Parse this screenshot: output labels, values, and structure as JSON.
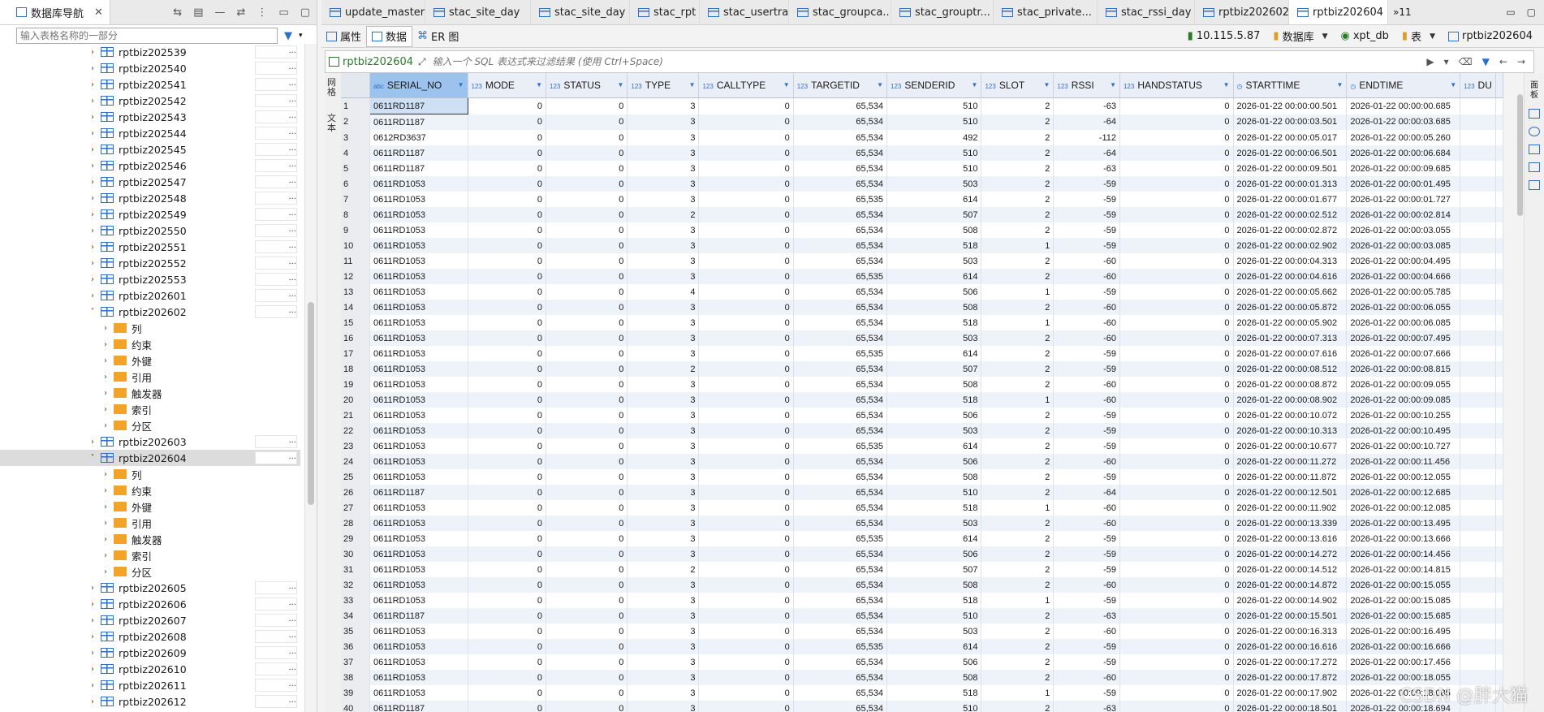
{
  "navigator": {
    "tab_label": "数据库导航",
    "filter_placeholder": "输入表格名称的一部分",
    "tree": [
      {
        "label": "rptbiz202539",
        "level": 1,
        "type": "table",
        "expanded": false
      },
      {
        "label": "rptbiz202540",
        "level": 1,
        "type": "table",
        "expanded": false
      },
      {
        "label": "rptbiz202541",
        "level": 1,
        "type": "table",
        "expanded": false
      },
      {
        "label": "rptbiz202542",
        "level": 1,
        "type": "table",
        "expanded": false
      },
      {
        "label": "rptbiz202543",
        "level": 1,
        "type": "table",
        "expanded": false
      },
      {
        "label": "rptbiz202544",
        "level": 1,
        "type": "table",
        "expanded": false
      },
      {
        "label": "rptbiz202545",
        "level": 1,
        "type": "table",
        "expanded": false
      },
      {
        "label": "rptbiz202546",
        "level": 1,
        "type": "table",
        "expanded": false
      },
      {
        "label": "rptbiz202547",
        "level": 1,
        "type": "table",
        "expanded": false
      },
      {
        "label": "rptbiz202548",
        "level": 1,
        "type": "table",
        "expanded": false
      },
      {
        "label": "rptbiz202549",
        "level": 1,
        "type": "table",
        "expanded": false
      },
      {
        "label": "rptbiz202550",
        "level": 1,
        "type": "table",
        "expanded": false
      },
      {
        "label": "rptbiz202551",
        "level": 1,
        "type": "table",
        "expanded": false
      },
      {
        "label": "rptbiz202552",
        "level": 1,
        "type": "table",
        "expanded": false
      },
      {
        "label": "rptbiz202553",
        "level": 1,
        "type": "table",
        "expanded": false
      },
      {
        "label": "rptbiz202601",
        "level": 1,
        "type": "table",
        "expanded": false
      },
      {
        "label": "rptbiz202602",
        "level": 1,
        "type": "table",
        "expanded": true
      },
      {
        "label": "列",
        "level": 2,
        "type": "col"
      },
      {
        "label": "约束",
        "level": 2,
        "type": "con"
      },
      {
        "label": "外键",
        "level": 2,
        "type": "folder"
      },
      {
        "label": "引用",
        "level": 2,
        "type": "folder"
      },
      {
        "label": "触发器",
        "level": 2,
        "type": "folder"
      },
      {
        "label": "索引",
        "level": 2,
        "type": "folder"
      },
      {
        "label": "分区",
        "level": 2,
        "type": "folder"
      },
      {
        "label": "rptbiz202603",
        "level": 1,
        "type": "table",
        "expanded": false
      },
      {
        "label": "rptbiz202604",
        "level": 1,
        "type": "table",
        "expanded": true,
        "selected": true
      },
      {
        "label": "列",
        "level": 2,
        "type": "col"
      },
      {
        "label": "约束",
        "level": 2,
        "type": "con"
      },
      {
        "label": "外键",
        "level": 2,
        "type": "folder"
      },
      {
        "label": "引用",
        "level": 2,
        "type": "folder"
      },
      {
        "label": "触发器",
        "level": 2,
        "type": "folder"
      },
      {
        "label": "索引",
        "level": 2,
        "type": "folder"
      },
      {
        "label": "分区",
        "level": 2,
        "type": "folder"
      },
      {
        "label": "rptbiz202605",
        "level": 1,
        "type": "table",
        "expanded": false
      },
      {
        "label": "rptbiz202606",
        "level": 1,
        "type": "table",
        "expanded": false
      },
      {
        "label": "rptbiz202607",
        "level": 1,
        "type": "table",
        "expanded": false
      },
      {
        "label": "rptbiz202608",
        "level": 1,
        "type": "table",
        "expanded": false
      },
      {
        "label": "rptbiz202609",
        "level": 1,
        "type": "table",
        "expanded": false
      },
      {
        "label": "rptbiz202610",
        "level": 1,
        "type": "table",
        "expanded": false
      },
      {
        "label": "rptbiz202611",
        "level": 1,
        "type": "table",
        "expanded": false
      },
      {
        "label": "rptbiz202612",
        "level": 1,
        "type": "table",
        "expanded": false
      }
    ],
    "more_label": "..."
  },
  "editor_tabs": [
    "update_master",
    "stac_site_day",
    "stac_site_day",
    "stac_rpt",
    "stac_usertra...",
    "stac_groupca...",
    "stac_grouptr...",
    "stac_private...",
    "stac_rssi_day",
    "rptbiz202602",
    "rptbiz202604"
  ],
  "active_tab_index": 10,
  "tab_overflow": "»11",
  "view_tabs": [
    "属性",
    "数据",
    "ER 图"
  ],
  "active_view": 1,
  "connection": {
    "host": "10.115.5.87",
    "db_label": "数据库",
    "db": "xpt_db",
    "table_label": "表",
    "table": "rptbiz202604"
  },
  "filter": {
    "table": "rptbiz202604",
    "placeholder": "输入一个 SQL 表达式来过滤结果 (使用 Ctrl+Space)"
  },
  "columns": [
    {
      "name": "SERIAL_NO",
      "type": "abc",
      "align": "left"
    },
    {
      "name": "MODE",
      "type": "123",
      "align": "right"
    },
    {
      "name": "STATUS",
      "type": "123",
      "align": "right"
    },
    {
      "name": "TYPE",
      "type": "123",
      "align": "right"
    },
    {
      "name": "CALLTYPE",
      "type": "123",
      "align": "right"
    },
    {
      "name": "TARGETID",
      "type": "123",
      "align": "right"
    },
    {
      "name": "SENDERID",
      "type": "123",
      "align": "right"
    },
    {
      "name": "SLOT",
      "type": "123",
      "align": "right"
    },
    {
      "name": "RSSI",
      "type": "123",
      "align": "right"
    },
    {
      "name": "HANDSTATUS",
      "type": "123",
      "align": "right"
    },
    {
      "name": "STARTTIME",
      "type": "clock",
      "align": "left"
    },
    {
      "name": "ENDTIME",
      "type": "clock",
      "align": "left"
    },
    {
      "name": "DU",
      "type": "123",
      "align": "left"
    }
  ],
  "rows": [
    [
      "0611RD1187",
      "0",
      "0",
      "3",
      "0",
      "65,534",
      "510",
      "2",
      "-63",
      "0",
      "2026-01-22 00:00:00.501",
      "2026-01-22 00:00:00.685"
    ],
    [
      "0611RD1187",
      "0",
      "0",
      "3",
      "0",
      "65,534",
      "510",
      "2",
      "-64",
      "0",
      "2026-01-22 00:00:03.501",
      "2026-01-22 00:00:03.685"
    ],
    [
      "0612RD3637",
      "0",
      "0",
      "3",
      "0",
      "65,534",
      "492",
      "2",
      "-112",
      "0",
      "2026-01-22 00:00:05.017",
      "2026-01-22 00:00:05.260"
    ],
    [
      "0611RD1187",
      "0",
      "0",
      "3",
      "0",
      "65,534",
      "510",
      "2",
      "-64",
      "0",
      "2026-01-22 00:00:06.501",
      "2026-01-22 00:00:06.684"
    ],
    [
      "0611RD1187",
      "0",
      "0",
      "3",
      "0",
      "65,534",
      "510",
      "2",
      "-63",
      "0",
      "2026-01-22 00:00:09.501",
      "2026-01-22 00:00:09.685"
    ],
    [
      "0611RD1053",
      "0",
      "0",
      "3",
      "0",
      "65,534",
      "503",
      "2",
      "-59",
      "0",
      "2026-01-22 00:00:01.313",
      "2026-01-22 00:00:01.495"
    ],
    [
      "0611RD1053",
      "0",
      "0",
      "3",
      "0",
      "65,535",
      "614",
      "2",
      "-59",
      "0",
      "2026-01-22 00:00:01.677",
      "2026-01-22 00:00:01.727"
    ],
    [
      "0611RD1053",
      "0",
      "0",
      "2",
      "0",
      "65,534",
      "507",
      "2",
      "-59",
      "0",
      "2026-01-22 00:00:02.512",
      "2026-01-22 00:00:02.814"
    ],
    [
      "0611RD1053",
      "0",
      "0",
      "3",
      "0",
      "65,534",
      "508",
      "2",
      "-59",
      "0",
      "2026-01-22 00:00:02.872",
      "2026-01-22 00:00:03.055"
    ],
    [
      "0611RD1053",
      "0",
      "0",
      "3",
      "0",
      "65,534",
      "518",
      "1",
      "-59",
      "0",
      "2026-01-22 00:00:02.902",
      "2026-01-22 00:00:03.085"
    ],
    [
      "0611RD1053",
      "0",
      "0",
      "3",
      "0",
      "65,534",
      "503",
      "2",
      "-60",
      "0",
      "2026-01-22 00:00:04.313",
      "2026-01-22 00:00:04.495"
    ],
    [
      "0611RD1053",
      "0",
      "0",
      "3",
      "0",
      "65,535",
      "614",
      "2",
      "-60",
      "0",
      "2026-01-22 00:00:04.616",
      "2026-01-22 00:00:04.666"
    ],
    [
      "0611RD1053",
      "0",
      "0",
      "4",
      "0",
      "65,534",
      "506",
      "1",
      "-59",
      "0",
      "2026-01-22 00:00:05.662",
      "2026-01-22 00:00:05.785"
    ],
    [
      "0611RD1053",
      "0",
      "0",
      "3",
      "0",
      "65,534",
      "508",
      "2",
      "-60",
      "0",
      "2026-01-22 00:00:05.872",
      "2026-01-22 00:00:06.055"
    ],
    [
      "0611RD1053",
      "0",
      "0",
      "3",
      "0",
      "65,534",
      "518",
      "1",
      "-60",
      "0",
      "2026-01-22 00:00:05.902",
      "2026-01-22 00:00:06.085"
    ],
    [
      "0611RD1053",
      "0",
      "0",
      "3",
      "0",
      "65,534",
      "503",
      "2",
      "-60",
      "0",
      "2026-01-22 00:00:07.313",
      "2026-01-22 00:00:07.495"
    ],
    [
      "0611RD1053",
      "0",
      "0",
      "3",
      "0",
      "65,535",
      "614",
      "2",
      "-59",
      "0",
      "2026-01-22 00:00:07.616",
      "2026-01-22 00:00:07.666"
    ],
    [
      "0611RD1053",
      "0",
      "0",
      "2",
      "0",
      "65,534",
      "507",
      "2",
      "-59",
      "0",
      "2026-01-22 00:00:08.512",
      "2026-01-22 00:00:08.815"
    ],
    [
      "0611RD1053",
      "0",
      "0",
      "3",
      "0",
      "65,534",
      "508",
      "2",
      "-60",
      "0",
      "2026-01-22 00:00:08.872",
      "2026-01-22 00:00:09.055"
    ],
    [
      "0611RD1053",
      "0",
      "0",
      "3",
      "0",
      "65,534",
      "518",
      "1",
      "-60",
      "0",
      "2026-01-22 00:00:08.902",
      "2026-01-22 00:00:09.085"
    ],
    [
      "0611RD1053",
      "0",
      "0",
      "3",
      "0",
      "65,534",
      "506",
      "2",
      "-59",
      "0",
      "2026-01-22 00:00:10.072",
      "2026-01-22 00:00:10.255"
    ],
    [
      "0611RD1053",
      "0",
      "0",
      "3",
      "0",
      "65,534",
      "503",
      "2",
      "-59",
      "0",
      "2026-01-22 00:00:10.313",
      "2026-01-22 00:00:10.495"
    ],
    [
      "0611RD1053",
      "0",
      "0",
      "3",
      "0",
      "65,535",
      "614",
      "2",
      "-59",
      "0",
      "2026-01-22 00:00:10.677",
      "2026-01-22 00:00:10.727"
    ],
    [
      "0611RD1053",
      "0",
      "0",
      "3",
      "0",
      "65,534",
      "506",
      "2",
      "-60",
      "0",
      "2026-01-22 00:00:11.272",
      "2026-01-22 00:00:11.456"
    ],
    [
      "0611RD1053",
      "0",
      "0",
      "3",
      "0",
      "65,534",
      "508",
      "2",
      "-59",
      "0",
      "2026-01-22 00:00:11.872",
      "2026-01-22 00:00:12.055"
    ],
    [
      "0611RD1187",
      "0",
      "0",
      "3",
      "0",
      "65,534",
      "510",
      "2",
      "-64",
      "0",
      "2026-01-22 00:00:12.501",
      "2026-01-22 00:00:12.685"
    ],
    [
      "0611RD1053",
      "0",
      "0",
      "3",
      "0",
      "65,534",
      "518",
      "1",
      "-60",
      "0",
      "2026-01-22 00:00:11.902",
      "2026-01-22 00:00:12.085"
    ],
    [
      "0611RD1053",
      "0",
      "0",
      "3",
      "0",
      "65,534",
      "503",
      "2",
      "-60",
      "0",
      "2026-01-22 00:00:13.339",
      "2026-01-22 00:00:13.495"
    ],
    [
      "0611RD1053",
      "0",
      "0",
      "3",
      "0",
      "65,535",
      "614",
      "2",
      "-59",
      "0",
      "2026-01-22 00:00:13.616",
      "2026-01-22 00:00:13.666"
    ],
    [
      "0611RD1053",
      "0",
      "0",
      "3",
      "0",
      "65,534",
      "506",
      "2",
      "-59",
      "0",
      "2026-01-22 00:00:14.272",
      "2026-01-22 00:00:14.456"
    ],
    [
      "0611RD1053",
      "0",
      "0",
      "2",
      "0",
      "65,534",
      "507",
      "2",
      "-59",
      "0",
      "2026-01-22 00:00:14.512",
      "2026-01-22 00:00:14.815"
    ],
    [
      "0611RD1053",
      "0",
      "0",
      "3",
      "0",
      "65,534",
      "508",
      "2",
      "-60",
      "0",
      "2026-01-22 00:00:14.872",
      "2026-01-22 00:00:15.055"
    ],
    [
      "0611RD1053",
      "0",
      "0",
      "3",
      "0",
      "65,534",
      "518",
      "1",
      "-59",
      "0",
      "2026-01-22 00:00:14.902",
      "2026-01-22 00:00:15.085"
    ],
    [
      "0611RD1187",
      "0",
      "0",
      "3",
      "0",
      "65,534",
      "510",
      "2",
      "-63",
      "0",
      "2026-01-22 00:00:15.501",
      "2026-01-22 00:00:15.685"
    ],
    [
      "0611RD1053",
      "0",
      "0",
      "3",
      "0",
      "65,534",
      "503",
      "2",
      "-60",
      "0",
      "2026-01-22 00:00:16.313",
      "2026-01-22 00:00:16.495"
    ],
    [
      "0611RD1053",
      "0",
      "0",
      "3",
      "0",
      "65,535",
      "614",
      "2",
      "-59",
      "0",
      "2026-01-22 00:00:16.616",
      "2026-01-22 00:00:16.666"
    ],
    [
      "0611RD1053",
      "0",
      "0",
      "3",
      "0",
      "65,534",
      "506",
      "2",
      "-59",
      "0",
      "2026-01-22 00:00:17.272",
      "2026-01-22 00:00:17.456"
    ],
    [
      "0611RD1053",
      "0",
      "0",
      "3",
      "0",
      "65,534",
      "508",
      "2",
      "-60",
      "0",
      "2026-01-22 00:00:17.872",
      "2026-01-22 00:00:18.055"
    ],
    [
      "0611RD1053",
      "0",
      "0",
      "3",
      "0",
      "65,534",
      "518",
      "1",
      "-59",
      "0",
      "2026-01-22 00:00:17.902",
      "2026-01-22 00:00:18.085"
    ],
    [
      "0611RD1187",
      "0",
      "0",
      "3",
      "0",
      "65,534",
      "510",
      "2",
      "-63",
      "0",
      "2026-01-22 00:00:18.501",
      "2026-01-22 00:00:18.694"
    ]
  ],
  "watermark": "CSDN @胖大猫"
}
